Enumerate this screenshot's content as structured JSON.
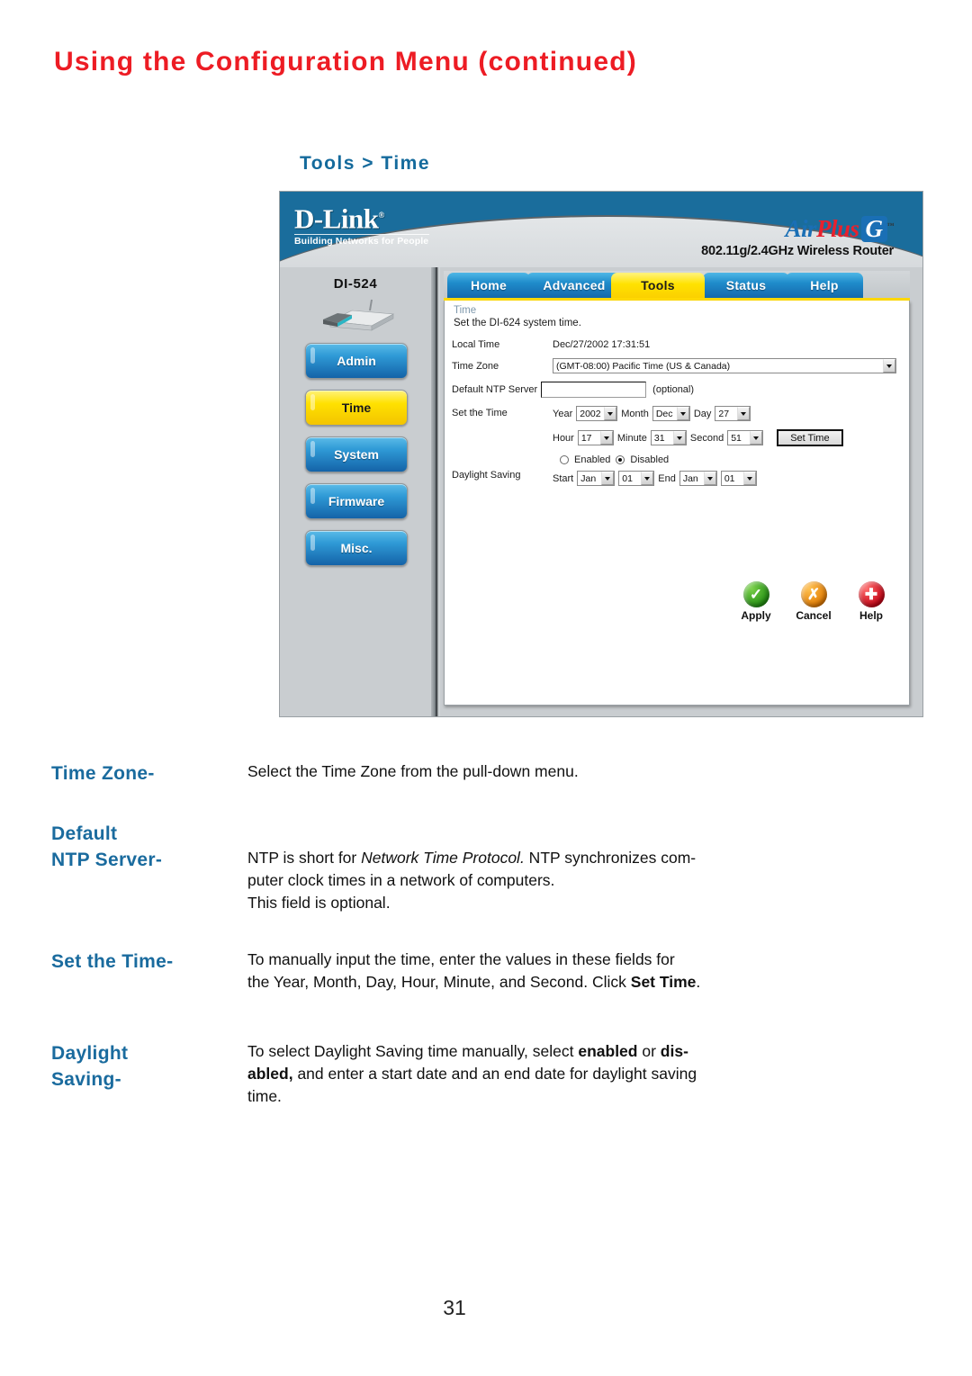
{
  "page": {
    "title": "Using the Configuration Menu (continued)",
    "number": "31",
    "title_color": "#ed1c24"
  },
  "section": {
    "heading": "Tools > Time",
    "heading_color": "#146a9c"
  },
  "screenshot": {
    "brand": {
      "logo": "D-Link",
      "registered": "®",
      "tagline": "Building Networks for People",
      "product_air": "Air",
      "product_plus": "Plus",
      "product_g": "G",
      "trademark": "™",
      "product_subtitle": "802.11g/2.4GHz Wireless Router"
    },
    "device": {
      "model": "DI-524",
      "nav_items": [
        {
          "label": "Admin",
          "active": false
        },
        {
          "label": "Time",
          "active": true
        },
        {
          "label": "System",
          "active": false
        },
        {
          "label": "Firmware",
          "active": false
        },
        {
          "label": "Misc.",
          "active": false
        }
      ]
    },
    "tabs": [
      {
        "label": "Home",
        "active": false
      },
      {
        "label": "Advanced",
        "active": false
      },
      {
        "label": "Tools",
        "active": true
      },
      {
        "label": "Status",
        "active": false
      },
      {
        "label": "Help",
        "active": false
      }
    ],
    "form": {
      "section_title": "Time",
      "section_desc": "Set the DI-624 system time.",
      "local_time_label": "Local Time",
      "local_time_value": "Dec/27/2002 17:31:51",
      "time_zone_label": "Time Zone",
      "time_zone_value": "(GMT-08:00) Pacific Time (US & Canada)",
      "ntp_label": "Default NTP Server",
      "ntp_value": "",
      "ntp_optional": "(optional)",
      "set_time_label": "Set the Time",
      "year_label": "Year",
      "year_value": "2002",
      "month_label": "Month",
      "month_value": "Dec",
      "day_label": "Day",
      "day_value": "27",
      "hour_label": "Hour",
      "hour_value": "17",
      "minute_label": "Minute",
      "minute_value": "31",
      "second_label": "Second",
      "second_value": "51",
      "set_time_button": "Set Time",
      "daylight_label": "Daylight Saving",
      "enabled_label": "Enabled",
      "disabled_label": "Disabled",
      "daylight_selected": "Disabled",
      "start_label": "Start",
      "start_month": "Jan",
      "start_day": "01",
      "end_label": "End",
      "end_month": "Jan",
      "end_day": "01"
    },
    "actions": [
      {
        "label": "Apply",
        "icon": "check-circle-icon",
        "color": "#1f8c10"
      },
      {
        "label": "Cancel",
        "icon": "x-circle-icon",
        "color": "#e07800"
      },
      {
        "label": "Help",
        "icon": "plus-circle-icon",
        "color": "#c20012"
      }
    ]
  },
  "descriptions": [
    {
      "term": "Time Zone-",
      "body_parts": [
        {
          "text": "Select the Time Zone from the pull-down menu.",
          "style": "normal"
        }
      ]
    },
    {
      "term_line1": "Default",
      "term_line2": "NTP Server-",
      "body_parts": [
        {
          "text": "NTP is short for ",
          "style": "normal"
        },
        {
          "text": "Network Time Protocol.",
          "style": "italic"
        },
        {
          "text": " NTP synchronizes computer clock times in a network of computers.",
          "style": "normal"
        },
        {
          "text": "\nThis field is optional.",
          "style": "normal"
        }
      ]
    },
    {
      "term": "Set the Time-",
      "body_parts": [
        {
          "text": "To manually input the time, enter the values in these fields for the Year, Month, Day, Hour, Minute, and Second. Click ",
          "style": "normal"
        },
        {
          "text": "Set Time",
          "style": "bold"
        },
        {
          "text": ".",
          "style": "normal"
        }
      ]
    },
    {
      "term_line1": "Daylight",
      "term_line2": "Saving-",
      "body_parts": [
        {
          "text": "To select Daylight Saving time manually, select ",
          "style": "normal"
        },
        {
          "text": "enabled",
          "style": "bold"
        },
        {
          "text": " or ",
          "style": "normal"
        },
        {
          "text": "disabled,",
          "style": "bold"
        },
        {
          "text": " and enter a start date and an end date for daylight saving time.",
          "style": "normal"
        }
      ]
    }
  ],
  "desc_text": {
    "time_zone_term": "Time Zone-",
    "time_zone_body": "Select the Time Zone from the pull-down menu.",
    "ntp_term1": "Default",
    "ntp_term2": "NTP Server-",
    "ntp_body_a": "NTP is short for ",
    "ntp_body_i": "Network Time Protocol.",
    "ntp_body_b": " NTP synchronizes com-",
    "ntp_body_c": "puter clock times in a network of computers.",
    "ntp_body_d": "This field is optional.",
    "settime_term": "Set the Time-",
    "settime_body_a": "To manually input the time, enter the values in these fields for",
    "settime_body_b": "the Year, Month, Day, Hour, Minute, and Second. Click ",
    "settime_body_bold": "Set Time",
    "settime_body_c": ".",
    "daylight_term1": "Daylight",
    "daylight_term2": "Saving-",
    "daylight_body_a": "To select Daylight Saving time manually, select ",
    "daylight_body_bold1": "enabled",
    "daylight_body_b": " or ",
    "daylight_body_bold2": "dis-",
    "daylight_body_bold3": "abled,",
    "daylight_body_c": " and enter a start date and an end date for daylight saving",
    "daylight_body_d": "time."
  }
}
